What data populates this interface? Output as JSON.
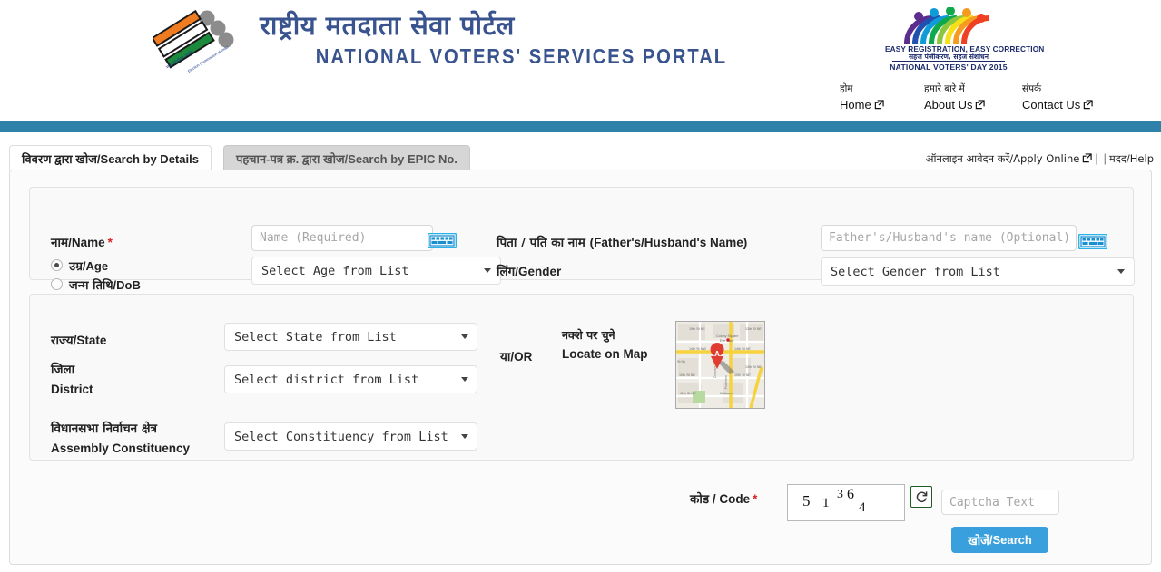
{
  "header": {
    "title_hi": "राष्ट्रीय मतदाता सेवा पोर्टल",
    "title_en": "NATIONAL VOTERS' SERVICES PORTAL",
    "eci_logo_name": "election-commission-of-india-logo",
    "nvd_logo": {
      "line1": "EASY REGISTRATION, EASY CORRECTION",
      "line2": "सहज पंजीकरण, सहज संशोधन",
      "line3": "NATIONAL VOTERS' DAY 2015"
    }
  },
  "nav": {
    "items": [
      {
        "hi": "होम",
        "en": "Home",
        "icon": "external-link-icon"
      },
      {
        "hi": "हमारे बारे में",
        "en": "About Us",
        "icon": "external-link-icon"
      },
      {
        "hi": "संपर्क",
        "en": "Contact Us",
        "icon": "external-link-icon"
      }
    ]
  },
  "tabs": [
    {
      "label": "विवरण द्वारा खोज/Search by Details",
      "active": true
    },
    {
      "label": "पहचान-पत्र क्र. द्वारा खोज/Search by EPIC No.",
      "active": false
    }
  ],
  "top_right_links": {
    "apply_online": "ऑनलाइन आवेदन करें/Apply Online",
    "separator": "|",
    "help": "मदद/Help"
  },
  "form": {
    "name": {
      "label_hi": "नाम",
      "label_en": "/Name",
      "required_mark": "*",
      "placeholder": "Name (Required)",
      "value": "",
      "keyboard_icon": "virtual-keyboard-icon"
    },
    "father_name": {
      "label_hi": "पिता / पति का नाम ",
      "label_en": "(Father's/Husband's Name)",
      "placeholder": "Father's/Husband's name (Optional)",
      "value": "",
      "keyboard_icon": "virtual-keyboard-icon"
    },
    "age_dob_radio": [
      {
        "label_hi": "उम्र",
        "label_en": "/Age",
        "selected": true
      },
      {
        "label_hi": "जन्म तिथि",
        "label_en": "/DoB",
        "selected": false
      }
    ],
    "age_select": {
      "value": "Select Age from List"
    },
    "gender": {
      "label_hi": "लिंग",
      "label_en": "/Gender",
      "value": "Select Gender from List"
    },
    "state": {
      "label_hi": "राज्य",
      "label_en": "/State",
      "value": "Select State from List"
    },
    "district": {
      "label_hi": "जिला",
      "label_en": "District",
      "value": "Select district from List"
    },
    "constituency": {
      "label_hi": "विधानसभा निर्वाचन क्षेत्र",
      "label_en": "Assembly Constituency",
      "value": "Select Constituency from List"
    },
    "or_label_hi": "या",
    "or_label_en": "/OR",
    "locate_map_hi": "नक्शे पर चुने",
    "locate_map_en": "Locate on Map",
    "map_thumbnail": {
      "marker": "A",
      "labels": [
        "19th St NE",
        "Colony Square Eye Care",
        "14th St NW",
        "14th St NE",
        "13th St NE",
        "10th St NE",
        "10th St NE",
        "11th St NE",
        "Midtown",
        "Crescent Ave NE",
        "St Ny"
      ]
    },
    "captcha": {
      "label_hi": "कोड",
      "label_en": " / Code",
      "required_mark": "*",
      "digits": [
        "5",
        "1",
        "3",
        "6",
        "4"
      ],
      "refresh_icon": "refresh-icon",
      "input_placeholder": "Captcha Text",
      "input_value": ""
    },
    "search_button": {
      "label_hi": "खोजें",
      "label_en": "/Search"
    }
  },
  "colors": {
    "teal_bar": "#2e81a8",
    "title_blue": "#39538f",
    "button_blue": "#3aa0dd",
    "required_red": "#d9241f",
    "captcha_refresh_border": "#1f5c25"
  }
}
